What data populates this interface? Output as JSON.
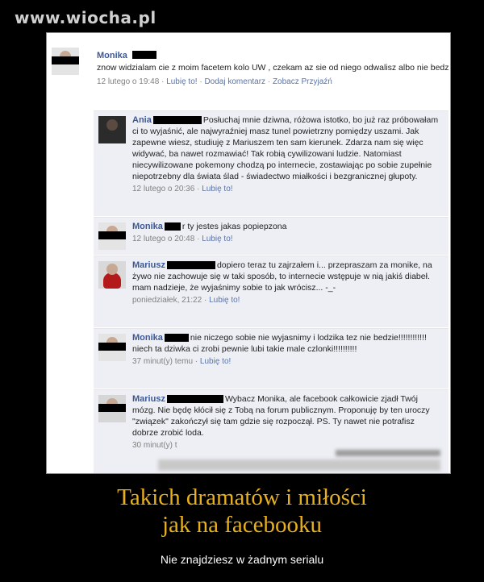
{
  "watermark": "www.wiocha.pl",
  "post": {
    "author": "Monika",
    "text": "znow widzialam cie z moim facetem kolo UW , czekam az sie od niego odwalisz albo nie bedzie dobrze !!",
    "time": "12 lutego o 19:48",
    "like": "Lubię to!",
    "comment": "Dodaj komentarz",
    "friendship": "Zobacz Przyjaźń"
  },
  "comments": [
    {
      "author": "Ania",
      "text": "Posłuchaj mnie dziwna, różowa istotko, bo już raz próbowałam ci to wyjaśnić, ale najwyraźniej masz tunel powietrzny pomiędzy uszami. Jak zapewne wiesz, studiuję z Mariuszem ten sam kierunek. Zdarza nam się więc widywać, ba nawet rozmawiać! Tak robią cywilizowani ludzie. Natomiast niecywilizowane pokemony chodzą po internecie, zostawiając po sobie zupełnie niepotrzebny dla świata ślad - świadectwo miałkości i bezgranicznej głupoty.",
      "time": "12 lutego o 20:36",
      "like": "Lubię to!"
    },
    {
      "author": "Monika",
      "text": "r ty jestes jakas popiepzona",
      "time": "12 lutego o 20:48",
      "like": "Lubię to!"
    },
    {
      "author": "Mariusz",
      "text": "dopiero teraz tu zajrzałem i... przepraszam za monike, na żywo nie zachowuje się w taki sposób, to internecie wstępuje w nią jakiś diabeł. mam nadzieje, że wyjaśnimy sobie to jak wrócisz... -_-",
      "time": "poniedziałek, 21:22",
      "like": "Lubię to!"
    },
    {
      "author": "Monika",
      "text": "nie niczego sobie nie wyjasnimy i lodzika tez nie bedzie!!!!!!!!!!!! niech ta dziwka ci zrobi pewnie lubi takie male czlonki!!!!!!!!!!",
      "time": "37 minut(y) temu",
      "like": "Lubię to!"
    },
    {
      "author": "Mariusz",
      "text": "Wybacz Monika, ale facebook całkowicie zjadł Twój mózg. Nie będę kłócił się z Tobą na forum publicznym. Proponuję by ten uroczy \"związek\" zakończył się tam gdzie się rozpoczął. PS. Ty nawet nie potrafisz dobrze zrobić loda.",
      "time": "30 minut(y) t"
    }
  ],
  "caption": {
    "line1": "Takich dramatów i miłości",
    "line2": "jak na facebooku"
  },
  "subcaption": "Nie znajdziesz w żadnym serialu"
}
